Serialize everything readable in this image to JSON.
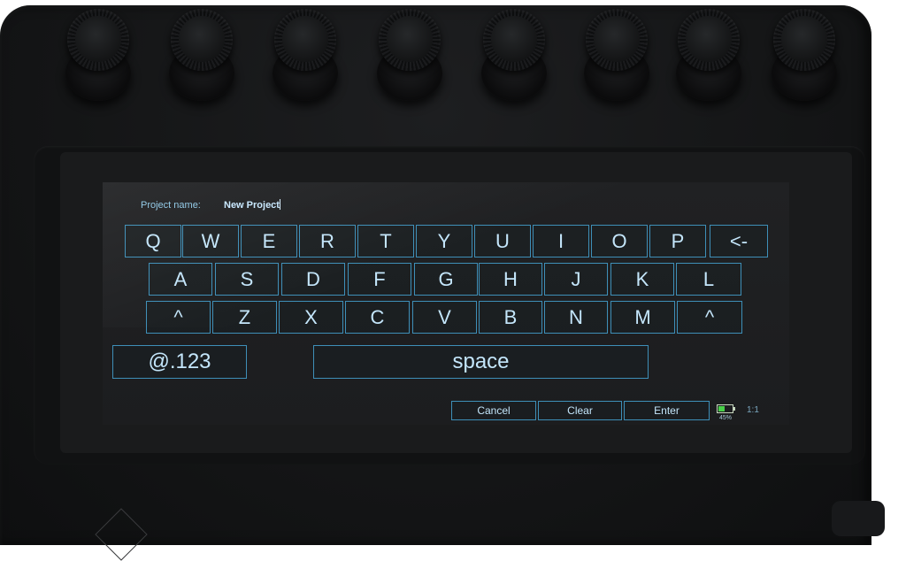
{
  "prompt": {
    "label": "Project name:",
    "value": "New Project"
  },
  "keyboard": {
    "row1": [
      "Q",
      "W",
      "E",
      "R",
      "T",
      "Y",
      "U",
      "I",
      "O",
      "P"
    ],
    "backspace": "<-",
    "row2": [
      "A",
      "S",
      "D",
      "F",
      "G",
      "H",
      "J",
      "K",
      "L"
    ],
    "shift_left": "^",
    "row3": [
      "Z",
      "X",
      "C",
      "V",
      "B",
      "N",
      "M"
    ],
    "shift_right": "^",
    "symbols": "@.123",
    "space": "space"
  },
  "actions": {
    "cancel": "Cancel",
    "clear": "Clear",
    "enter": "Enter"
  },
  "status": {
    "battery_percent": "45%",
    "battery_level": 0.45,
    "zoom": "1:1"
  },
  "colors": {
    "key_outline": "#3e8fb8",
    "key_text": "#c4e6fb",
    "battery_fill": "#48d048"
  }
}
